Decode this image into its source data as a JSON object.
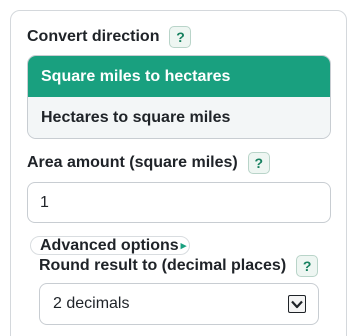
{
  "direction": {
    "label": "Convert direction",
    "help": "?",
    "options": [
      {
        "label": "Square miles to hectares",
        "selected": true
      },
      {
        "label": "Hectares to square miles",
        "selected": false
      }
    ]
  },
  "amount": {
    "label": "Area amount (square miles)",
    "help": "?",
    "value": "1"
  },
  "advanced": {
    "summary": "Advanced options",
    "round": {
      "label": "Round result to (decimal places)",
      "help": "?",
      "selected": "2 decimals"
    }
  },
  "colors": {
    "accent": "#19a07f",
    "help_bg": "#eef6f2"
  }
}
